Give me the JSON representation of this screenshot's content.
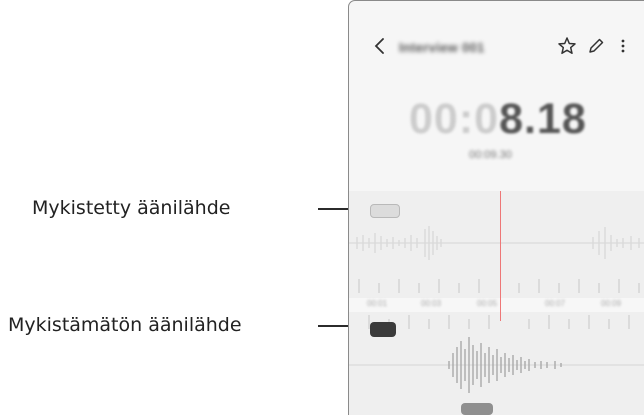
{
  "callouts": {
    "muted": "Mykistetty äänilähde",
    "unmuted": "Mykistämätön äänilähde"
  },
  "phone": {
    "title": "Interview 001",
    "timer": {
      "dim": "00:0",
      "bright": "8.18"
    },
    "subtime": "00:09.30",
    "ruler": [
      "00:01",
      "00:03",
      "00:05",
      "00:07",
      "00:09"
    ],
    "icons": [
      "back-arrow-icon",
      "star-icon",
      "pen-icon",
      "more-vertical-icon"
    ]
  },
  "colors": {
    "playhead": "#e77777",
    "active_track": "#3b3b3b",
    "muted_track": "#dcdcdc"
  }
}
